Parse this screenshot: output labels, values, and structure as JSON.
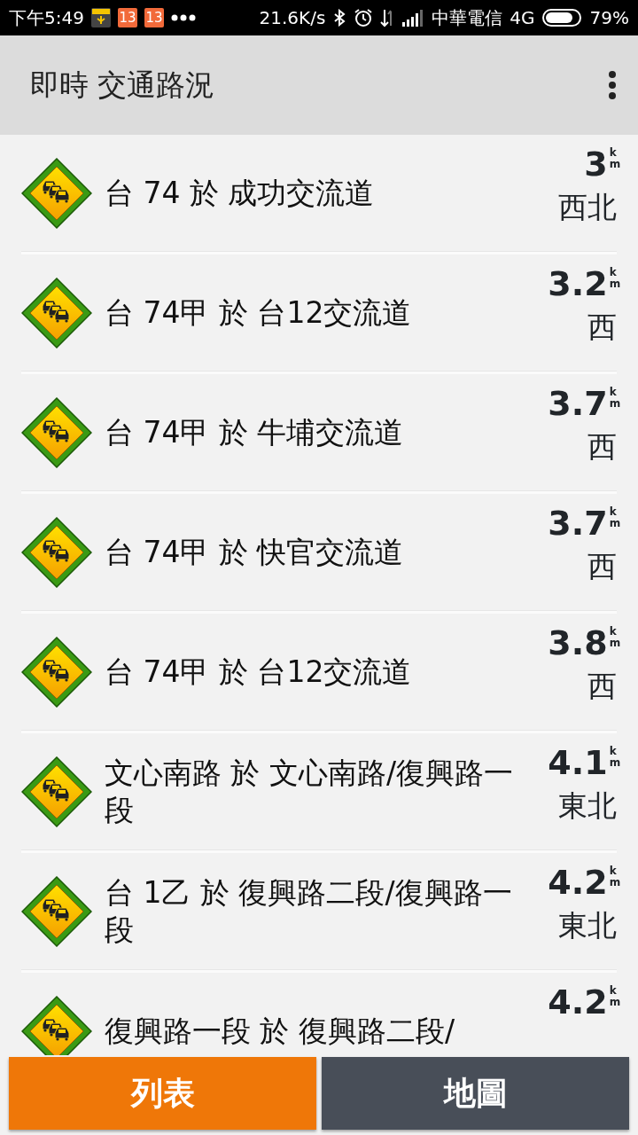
{
  "status_bar": {
    "time": "下午5:49",
    "notifications": [
      "13",
      "13"
    ],
    "speed": "21.6K/s",
    "carrier": "中華電信",
    "network": "4G",
    "battery": "79%"
  },
  "app_bar": {
    "title": "即時 交通路況"
  },
  "incidents": [
    {
      "name": "台 74 於 成功交流道",
      "distance": "3",
      "unit": "km",
      "direction": "西北"
    },
    {
      "name": "台 74甲 於 台12交流道",
      "distance": "3.2",
      "unit": "km",
      "direction": "西"
    },
    {
      "name": "台 74甲 於 牛埔交流道",
      "distance": "3.7",
      "unit": "km",
      "direction": "西"
    },
    {
      "name": "台 74甲 於 快官交流道",
      "distance": "3.7",
      "unit": "km",
      "direction": "西"
    },
    {
      "name": "台 74甲 於 台12交流道",
      "distance": "3.8",
      "unit": "km",
      "direction": "西"
    },
    {
      "name": "文心南路 於 文心南路/復興路一段",
      "distance": "4.1",
      "unit": "km",
      "direction": "東北"
    },
    {
      "name": "台 1乙 於 復興路二段/復興路一段",
      "distance": "4.2",
      "unit": "km",
      "direction": "東北"
    },
    {
      "name": "復興路一段 於 復興路二段/",
      "distance": "4.2",
      "unit": "km"
    }
  ],
  "bottom_tabs": [
    {
      "label": "列表",
      "selected": true
    },
    {
      "label": "地圖",
      "selected": false
    }
  ]
}
